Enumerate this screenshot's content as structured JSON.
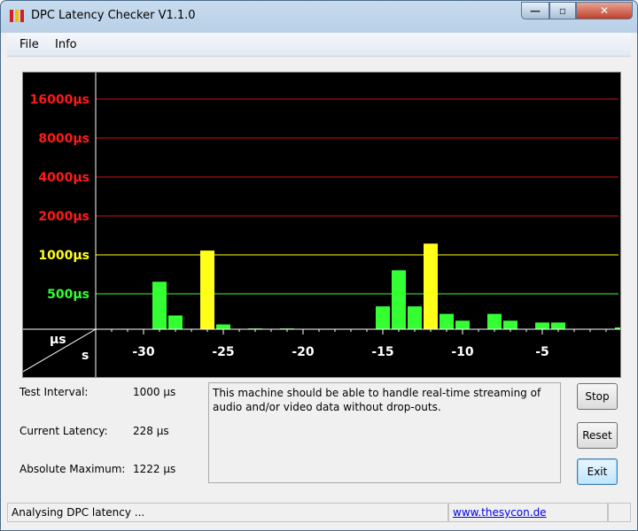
{
  "window": {
    "title": "DPC Latency Checker V1.1.0",
    "controls": {
      "minimize": "—",
      "maximize": "▫",
      "close": "✕"
    }
  },
  "menu": [
    {
      "label": "File"
    },
    {
      "label": "Info"
    }
  ],
  "chart_data": {
    "type": "bar",
    "y_unit": "µs",
    "x_unit": "s",
    "y_axis_label": "µs",
    "x_axis_label": "s",
    "y_scale": "log",
    "y_ticks": [
      {
        "label": "16000µs",
        "value": 16000,
        "color": "#ff1a1a"
      },
      {
        "label": "8000µs",
        "value": 8000,
        "color": "#ff1a1a"
      },
      {
        "label": "4000µs",
        "value": 4000,
        "color": "#ff1a1a"
      },
      {
        "label": "2000µs",
        "value": 2000,
        "color": "#ff1a1a"
      },
      {
        "label": "1000µs",
        "value": 1000,
        "color": "#ffff1a"
      },
      {
        "label": "500µs",
        "value": 500,
        "color": "#33ff33"
      }
    ],
    "x_ticks": [
      {
        "label": "-30",
        "value": -30
      },
      {
        "label": "-25",
        "value": -25
      },
      {
        "label": "-20",
        "value": -20
      },
      {
        "label": "-15",
        "value": -15
      },
      {
        "label": "-10",
        "value": -10
      },
      {
        "label": "-5",
        "value": -5
      }
    ],
    "x_range": [
      -32.5,
      0
    ],
    "bars": [
      {
        "x": -32,
        "value": 250,
        "color": "#33ff33"
      },
      {
        "x": -31,
        "value": 250,
        "color": "#33ff33"
      },
      {
        "x": -30,
        "value": 245,
        "color": "#33ff33"
      },
      {
        "x": -29,
        "value": 620,
        "color": "#33ff33"
      },
      {
        "x": -28,
        "value": 340,
        "color": "#33ff33"
      },
      {
        "x": -27,
        "value": 250,
        "color": "#33ff33"
      },
      {
        "x": -26,
        "value": 1080,
        "color": "#ffff1a"
      },
      {
        "x": -25,
        "value": 290,
        "color": "#33ff33"
      },
      {
        "x": -24,
        "value": 250,
        "color": "#33ff33"
      },
      {
        "x": -23,
        "value": 270,
        "color": "#33ff33"
      },
      {
        "x": -22,
        "value": 250,
        "color": "#33ff33"
      },
      {
        "x": -21,
        "value": 270,
        "color": "#33ff33"
      },
      {
        "x": -20,
        "value": 240,
        "color": "#33ff33"
      },
      {
        "x": -19,
        "value": 250,
        "color": "#33ff33"
      },
      {
        "x": -18,
        "value": 235,
        "color": "#33ff33"
      },
      {
        "x": -17,
        "value": 260,
        "color": "#33ff33"
      },
      {
        "x": -16,
        "value": 260,
        "color": "#33ff33"
      },
      {
        "x": -15,
        "value": 400,
        "color": "#33ff33"
      },
      {
        "x": -14,
        "value": 760,
        "color": "#33ff33"
      },
      {
        "x": -13,
        "value": 400,
        "color": "#33ff33"
      },
      {
        "x": -12,
        "value": 1222,
        "color": "#ffff1a"
      },
      {
        "x": -11,
        "value": 350,
        "color": "#33ff33"
      },
      {
        "x": -10,
        "value": 310,
        "color": "#33ff33"
      },
      {
        "x": -9,
        "value": 240,
        "color": "#33ff33"
      },
      {
        "x": -8,
        "value": 350,
        "color": "#33ff33"
      },
      {
        "x": -7,
        "value": 310,
        "color": "#33ff33"
      },
      {
        "x": -6,
        "value": 250,
        "color": "#33ff33"
      },
      {
        "x": -5,
        "value": 300,
        "color": "#33ff33"
      },
      {
        "x": -4,
        "value": 300,
        "color": "#33ff33"
      },
      {
        "x": -3,
        "value": 225,
        "color": "#33ff33"
      },
      {
        "x": -2,
        "value": 255,
        "color": "#33ff33"
      },
      {
        "x": -1,
        "value": 250,
        "color": "#33ff33"
      },
      {
        "x": 0,
        "value": 275,
        "color": "#33ff33"
      }
    ]
  },
  "info": {
    "test_interval": {
      "label": "Test Interval:",
      "value": "1000 µs"
    },
    "current_latency": {
      "label": "Current Latency:",
      "value": "228 µs"
    },
    "absolute_maximum": {
      "label": "Absolute Maximum:",
      "value": "1222 µs"
    }
  },
  "message": "This machine should be able to handle real-time streaming of audio and/or video data without drop-outs.",
  "buttons": {
    "stop": "Stop",
    "reset": "Reset",
    "exit": "Exit"
  },
  "status": {
    "text": "Analysing DPC latency ...",
    "link": "www.thesycon.de"
  }
}
